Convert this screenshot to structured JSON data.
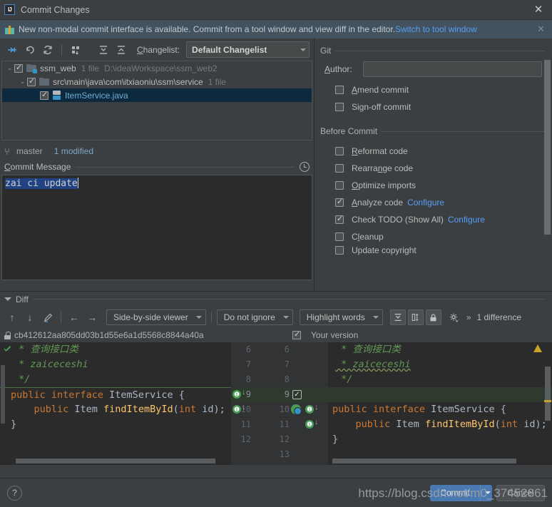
{
  "window": {
    "title": "Commit Changes",
    "close_label": "✕",
    "logo_text": "IJ"
  },
  "notification": {
    "icon": "gift-icon",
    "message": "New non-modal commit interface is available. Commit from a tool window and view diff in the editor.",
    "link": "Switch to tool window",
    "close_label": "✕"
  },
  "toolbar": {
    "icons": [
      "show-diff-icon",
      "rollback-icon",
      "refresh-icon",
      "group-by-icon",
      "expand-all-icon",
      "collapse-all-icon"
    ],
    "changelist_label": "Changelist:",
    "changelist_value": "Default Changelist"
  },
  "file_tree": {
    "rows": [
      {
        "indent": 0,
        "twisty": "⌄",
        "checked": true,
        "icon": "module-folder-icon",
        "name": "ssm_web",
        "meta": "1 file",
        "path": "D:\\ideaWorkspace\\ssm_web2",
        "selected": false,
        "is_file": false
      },
      {
        "indent": 1,
        "twisty": "⌄",
        "checked": true,
        "icon": "folder-icon",
        "name": "src\\main\\java\\com\\itxiaoniu\\ssm\\service",
        "meta": "1 file",
        "path": "",
        "selected": false,
        "is_file": false
      },
      {
        "indent": 2,
        "twisty": "",
        "checked": true,
        "icon": "java-file-icon",
        "name": "ItemService.java",
        "meta": "",
        "path": "",
        "selected": true,
        "is_file": true
      }
    ]
  },
  "branch_bar": {
    "icon": "git-branch-icon",
    "branch": "master",
    "status": "1 modified"
  },
  "commit_message": {
    "title": "Commit Message",
    "history_icon": "clock-icon",
    "value": "zai ci update"
  },
  "git_section": {
    "title": "Git",
    "author_label": "Author:",
    "author_value": "",
    "author_placeholder": "",
    "options": [
      {
        "label": "Amend commit",
        "checked": false
      },
      {
        "label": "Sign-off commit",
        "checked": false
      }
    ]
  },
  "before_commit": {
    "title": "Before Commit",
    "options": [
      {
        "label": "Reformat code",
        "checked": false,
        "link": ""
      },
      {
        "label": "Rearrange code",
        "checked": false,
        "link": ""
      },
      {
        "label": "Optimize imports",
        "checked": false,
        "link": ""
      },
      {
        "label": "Analyze code",
        "checked": true,
        "link": "Configure"
      },
      {
        "label": "Check TODO (Show All)",
        "checked": true,
        "link": "Configure"
      },
      {
        "label": "Cleanup",
        "checked": false,
        "link": ""
      },
      {
        "label": "Update copyright",
        "checked": false,
        "link": ""
      }
    ]
  },
  "diff": {
    "section_title": "Diff",
    "toolbar": {
      "prev_icon": "arrow-up-icon",
      "next_icon": "arrow-down-icon",
      "edit_icon": "pencil-icon",
      "accept_left_icon": "arrow-left-icon",
      "accept_right_icon": "arrow-right-icon",
      "viewer_mode": "Side-by-side viewer",
      "ignore_mode": "Do not ignore",
      "highlight_mode": "Highlight words",
      "collapse_icon": "collapse-unchanged-icon",
      "columns_icon": "two-column-icon",
      "lock_icon": "lock-icon",
      "settings_icon": "gear-icon",
      "more_icon": "chevron-double-right-icon",
      "difference_count": "1 difference"
    },
    "left_header": {
      "lock_icon": "lock-icon",
      "label": "cb412612aa805dd03b1d55e6a1d5568c8844a40a"
    },
    "right_header": {
      "checked": true,
      "label": "Your version"
    },
    "left_lines": [
      {
        "num": "6",
        "segments": [
          {
            "t": " * 查询接口类",
            "c": "cmt"
          }
        ],
        "inserted": false
      },
      {
        "num": "7",
        "segments": [
          {
            "t": " * zaiceceshi",
            "c": "cmt"
          }
        ],
        "inserted": false
      },
      {
        "num": "8",
        "segments": [
          {
            "t": " */",
            "c": "cmt"
          }
        ],
        "inserted": false
      },
      {
        "num": "9",
        "segments": [
          {
            "t": "public interface ",
            "c": "kw"
          },
          {
            "t": "ItemService ",
            "c": "cls"
          },
          {
            "t": "{",
            "c": "plain"
          }
        ],
        "inserted": false
      },
      {
        "num": "10",
        "segments": [
          {
            "t": "    public ",
            "c": "kw"
          },
          {
            "t": "Item ",
            "c": "cls"
          },
          {
            "t": "findItemById",
            "c": "ident"
          },
          {
            "t": "(",
            "c": "plain"
          },
          {
            "t": "int ",
            "c": "kw"
          },
          {
            "t": "id);",
            "c": "plain"
          }
        ],
        "inserted": false
      },
      {
        "num": "11",
        "segments": [
          {
            "t": "}",
            "c": "plain"
          }
        ],
        "inserted": false
      },
      {
        "num": "12",
        "segments": [
          {
            "t": "",
            "c": "plain"
          }
        ],
        "inserted": false
      }
    ],
    "right_lines": [
      {
        "num": "6",
        "segments": [
          {
            "t": " * 查询接口类",
            "c": "cmt"
          }
        ],
        "inserted": false
      },
      {
        "num": "7",
        "segments": [
          {
            "t": " * zaiceceshi",
            "c": "cmt",
            "squiggle": true
          }
        ],
        "inserted": false
      },
      {
        "num": "8",
        "segments": [
          {
            "t": " */",
            "c": "cmt"
          }
        ],
        "inserted": false
      },
      {
        "num": "9",
        "segments": [
          {
            "t": "",
            "c": "plain"
          }
        ],
        "inserted": true
      },
      {
        "num": "10",
        "segments": [
          {
            "t": "public interface ",
            "c": "kw"
          },
          {
            "t": "ItemService ",
            "c": "cls"
          },
          {
            "t": "{",
            "c": "plain"
          }
        ],
        "inserted": false
      },
      {
        "num": "11",
        "segments": [
          {
            "t": "    public ",
            "c": "kw"
          },
          {
            "t": "Item ",
            "c": "cls"
          },
          {
            "t": "findItemById",
            "c": "ident"
          },
          {
            "t": "(",
            "c": "plain"
          },
          {
            "t": "int ",
            "c": "kw"
          },
          {
            "t": "id);",
            "c": "plain"
          }
        ],
        "inserted": false
      },
      {
        "num": "12",
        "segments": [
          {
            "t": "}",
            "c": "plain"
          }
        ],
        "inserted": false
      },
      {
        "num": "13",
        "segments": [
          {
            "t": "",
            "c": "plain"
          }
        ],
        "inserted": false
      }
    ],
    "warning_icon": "warning-triangle-icon"
  },
  "footer": {
    "help_label": "?",
    "commit_label": "Commit",
    "commit_caret": "▾",
    "cancel_label": "Cancel"
  },
  "watermark": "https://blog.csdn.net/m0_37452861",
  "colors": {
    "background": "#3c3f41",
    "editor_background": "#2b2b2b",
    "accent_blue": "#4a78b0",
    "link_blue": "#589df6",
    "selection_blue": "#214283",
    "tree_selection": "#0d293e",
    "inserted_green": "#2f3a2f",
    "accept_green": "#499c54",
    "comment_green": "#629755",
    "keyword_orange": "#cc7832",
    "method_yellow": "#ffc66d",
    "notification_bg": "#43525f"
  }
}
